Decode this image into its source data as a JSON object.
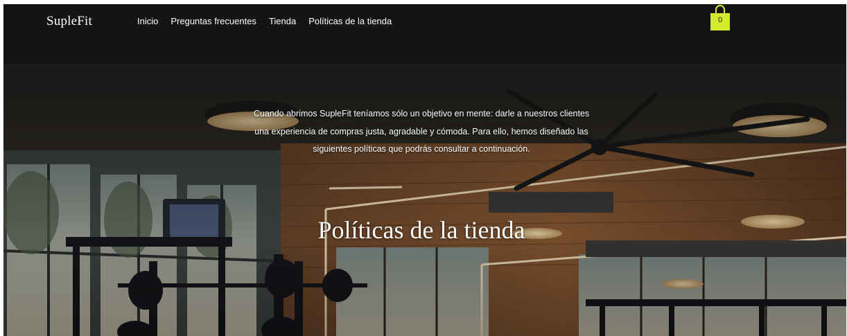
{
  "site": {
    "logo": "SupleFit"
  },
  "nav": {
    "items": [
      {
        "label": "Inicio"
      },
      {
        "label": "Preguntas frecuentes"
      },
      {
        "label": "Tienda"
      },
      {
        "label": "Políticas de la tienda"
      }
    ]
  },
  "cart": {
    "count": "0",
    "icon": "shopping-bag-icon",
    "color": "#d4ea2c"
  },
  "hero": {
    "intro": "Cuando abrimos SupleFit teníamos sólo un objetivo en mente: darle a nuestros clientes una experiencia de compras justa, agradable y cómoda. Para ello, hemos diseñado las siguientes políticas que podrás consultar a continuación.",
    "title": "Políticas de la tienda"
  },
  "colors": {
    "header_bg": "#141414",
    "accent": "#d4ea2c",
    "text": "#ffffff"
  }
}
